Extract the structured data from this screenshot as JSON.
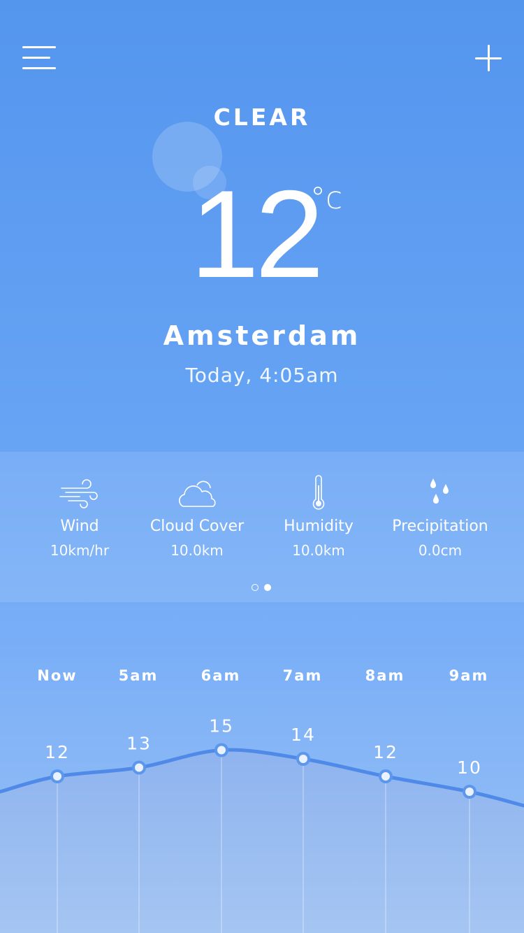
{
  "header": {
    "condition": "CLEAR",
    "temperature": "12",
    "unit": "°c",
    "city": "Amsterdam",
    "datetime": "Today, 4:05am"
  },
  "stats": [
    {
      "label": "Wind",
      "value": "10km/hr",
      "icon": "wind-icon"
    },
    {
      "label": "Cloud Cover",
      "value": "10.0km",
      "icon": "cloud-icon"
    },
    {
      "label": "Humidity",
      "value": "10.0km",
      "icon": "thermometer-icon"
    },
    {
      "label": "Precipitation",
      "value": "0.0cm",
      "icon": "raindrops-icon"
    }
  ],
  "pager": {
    "pages": 2,
    "active": 2
  },
  "hourly": {
    "labels": [
      "Now",
      "5am",
      "6am",
      "7am",
      "8am",
      "9am"
    ],
    "temps": [
      "12",
      "13",
      "15",
      "14",
      "12",
      "10"
    ]
  },
  "chart_data": {
    "type": "area",
    "categories": [
      "Now",
      "5am",
      "6am",
      "7am",
      "8am",
      "9am"
    ],
    "values": [
      12,
      13,
      15,
      14,
      12,
      10
    ],
    "title": "",
    "xlabel": "",
    "ylabel": "",
    "grid": false
  },
  "colors": {
    "background_top": "#5495ee",
    "background_bottom": "#9cc2f5",
    "line": "#4f8ae8",
    "text": "#ffffff"
  }
}
